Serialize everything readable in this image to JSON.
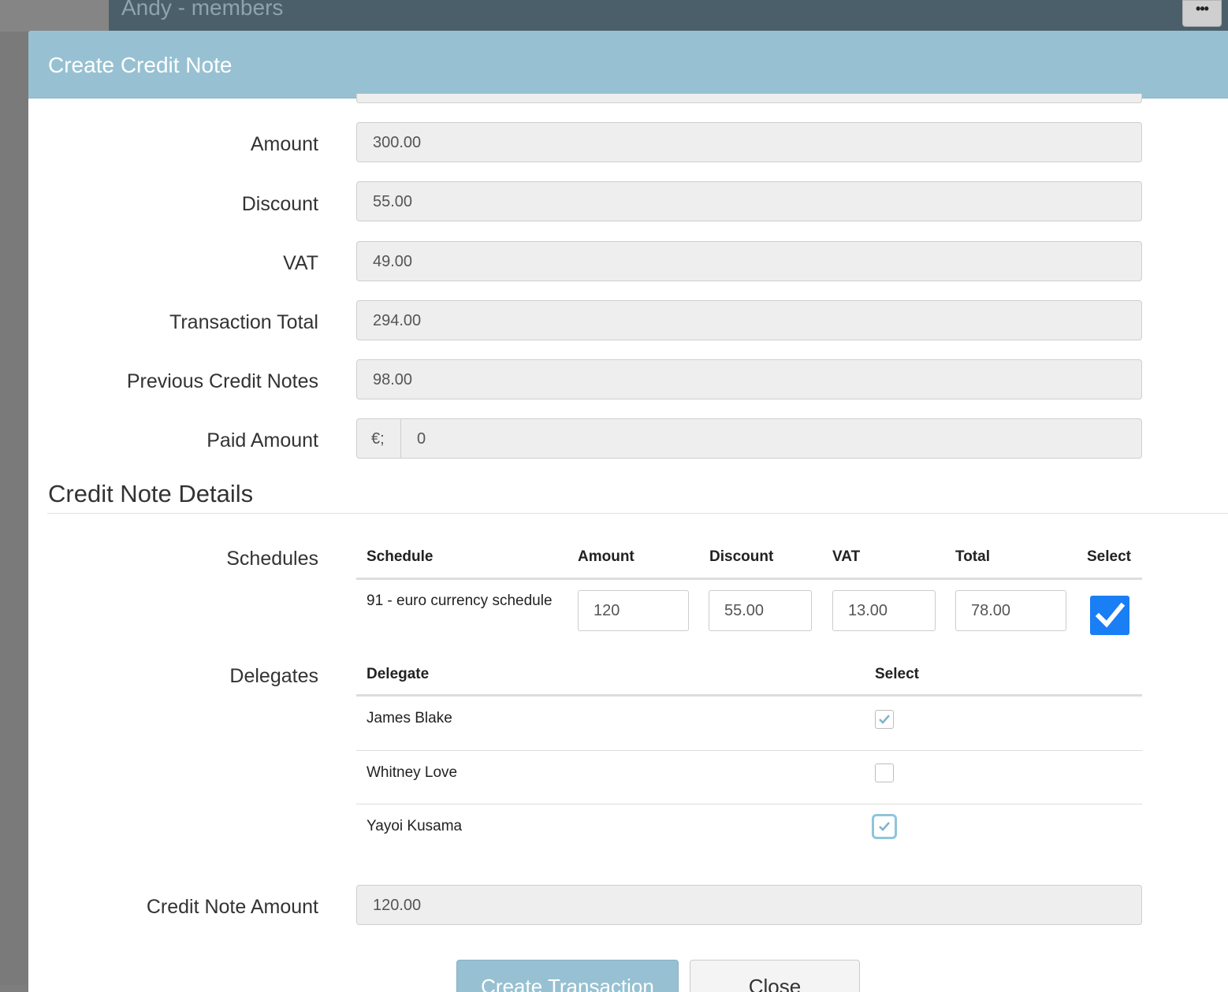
{
  "background": {
    "title": "Andy - members",
    "more_button": "•••"
  },
  "modal": {
    "title": "Create Credit Note"
  },
  "form": {
    "amount_label": "Amount",
    "amount_value": "300.00",
    "discount_label": "Discount",
    "discount_value": "55.00",
    "vat_label": "VAT",
    "vat_value": "49.00",
    "transaction_total_label": "Transaction Total",
    "transaction_total_value": "294.00",
    "previous_credit_notes_label": "Previous Credit Notes",
    "previous_credit_notes_value": "98.00",
    "paid_amount_label": "Paid Amount",
    "paid_amount_currency": "€;",
    "paid_amount_value": "0"
  },
  "details": {
    "section_title": "Credit Note Details",
    "schedules_label": "Schedules",
    "schedules_headers": {
      "schedule": "Schedule",
      "amount": "Amount",
      "discount": "Discount",
      "vat": "VAT",
      "total": "Total",
      "select": "Select"
    },
    "schedule_row": {
      "name": "91 - euro currency schedule",
      "amount": "120",
      "discount": "55.00",
      "vat": "13.00",
      "total": "78.00",
      "selected": true
    },
    "delegates_label": "Delegates",
    "delegates_headers": {
      "delegate": "Delegate",
      "select": "Select"
    },
    "delegates": [
      {
        "name": "James Blake",
        "checked": true
      },
      {
        "name": "Whitney Love",
        "checked": false
      },
      {
        "name": "Yayoi Kusama",
        "checked": true
      }
    ],
    "credit_note_amount_label": "Credit Note Amount",
    "credit_note_amount_value": "120.00"
  },
  "buttons": {
    "create": "Create Transaction",
    "close": "Close"
  },
  "colors": {
    "header": "#97c1d2",
    "checkbox_selected": "#1a7ef5",
    "check_tick": "#7fb3cc"
  }
}
